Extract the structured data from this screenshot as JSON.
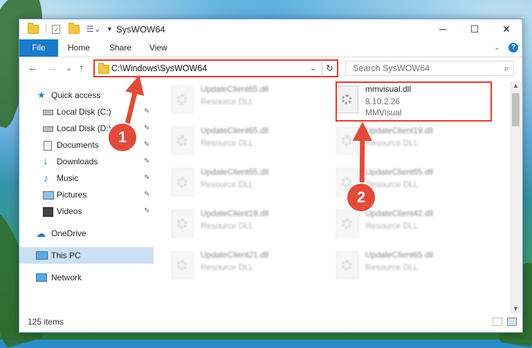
{
  "window": {
    "title": "SysWOW64"
  },
  "window_controls": {
    "minimize": "─",
    "maximize": "☐",
    "close": "✕"
  },
  "ribbon": {
    "file_tab": "File",
    "tabs": [
      "Home",
      "Share",
      "View"
    ],
    "expand": "⌄",
    "help": "?"
  },
  "nav": {
    "back": "←",
    "forward": "→",
    "recent": "⌄",
    "up": "↑",
    "address": "C:\\Windows\\SysWOW64",
    "address_dropdown": "⌄",
    "refresh": "↻",
    "search_placeholder": "Search SysWOW64",
    "search_icon": "⌕"
  },
  "sidebar": {
    "items": [
      {
        "label": "Quick access",
        "icon": "star-icon",
        "pinned": false
      },
      {
        "label": "Local Disk (C:)",
        "icon": "drive-icon",
        "pinned": true
      },
      {
        "label": "Local Disk (D:)",
        "icon": "drive-icon",
        "pinned": true
      },
      {
        "label": "Documents",
        "icon": "documents-icon",
        "pinned": true
      },
      {
        "label": "Downloads",
        "icon": "downloads-icon",
        "pinned": true
      },
      {
        "label": "Music",
        "icon": "music-icon",
        "pinned": true
      },
      {
        "label": "Pictures",
        "icon": "pictures-icon",
        "pinned": true
      },
      {
        "label": "Videos",
        "icon": "videos-icon",
        "pinned": true
      },
      {
        "label": "OneDrive",
        "icon": "cloud-icon",
        "pinned": false
      },
      {
        "label": "This PC",
        "icon": "pc-icon",
        "pinned": false,
        "selected": true
      },
      {
        "label": "Network",
        "icon": "network-icon",
        "pinned": false
      }
    ],
    "pin_glyph": "📌"
  },
  "files": [
    {
      "name": "UpdateClient65.dll",
      "desc": "Resource DLL",
      "blurred": true
    },
    {
      "name": "mmvisual.dll",
      "desc": "8.10.2.26",
      "desc2": "MMVisual",
      "blurred": false,
      "highlighted": true
    },
    {
      "name": "UpdateClient65.dll",
      "desc": "Resource DLL",
      "blurred": true
    },
    {
      "name": "UpdateClient19.dll",
      "desc": "Resource DLL",
      "blurred": true
    },
    {
      "name": "UpdateClient65.dll",
      "desc": "Resource DLL",
      "blurred": true
    },
    {
      "name": "UpdateClient65.dll",
      "desc": "Resource DLL",
      "blurred": true
    },
    {
      "name": "UpdateClient19.dll",
      "desc": "Resource DLL",
      "blurred": true
    },
    {
      "name": "UpdateClient42.dll",
      "desc": "Resource DLL",
      "blurred": true
    },
    {
      "name": "UpdateClient21.dll",
      "desc": "Resource DLL",
      "blurred": true
    },
    {
      "name": "UpdateClient65.dll",
      "desc": "Resource DLL",
      "blurred": true
    }
  ],
  "status": {
    "item_count": "125 items"
  },
  "scrollbar": {
    "up": "▲",
    "down": "▼"
  },
  "annotations": {
    "marker_1": "1",
    "marker_2": "2",
    "color": "#e24a3a"
  },
  "colors": {
    "accent": "#1979ca",
    "highlight_border": "#e0392b",
    "selected_bg": "#cce0f4"
  }
}
